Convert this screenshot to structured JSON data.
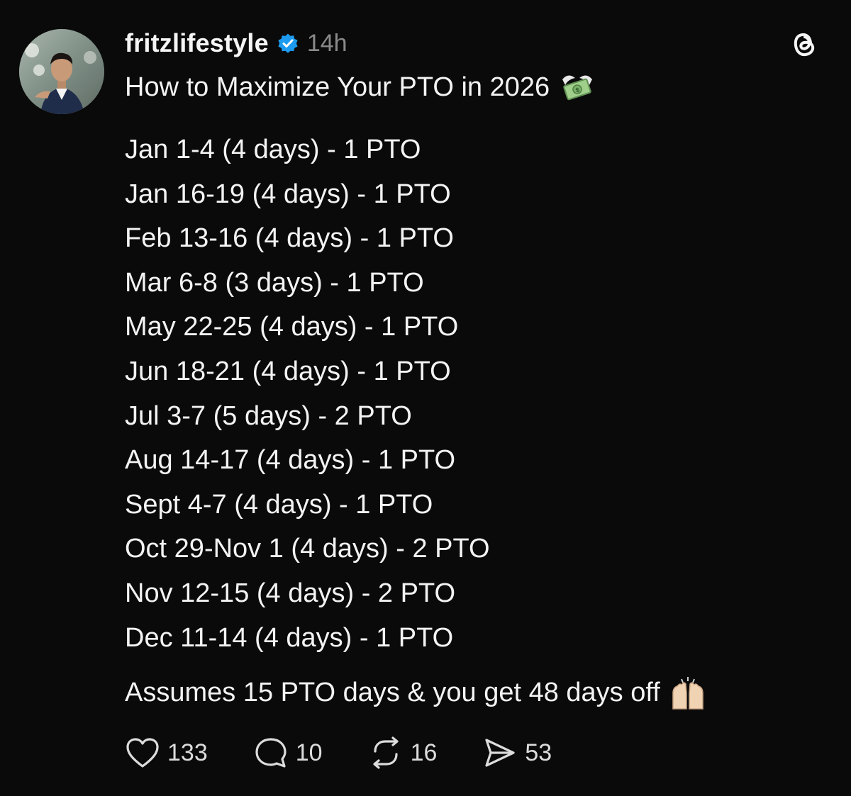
{
  "post": {
    "username": "fritzlifestyle",
    "timestamp": "14h",
    "title": "How to Maximize Your PTO in 2026",
    "title_emoji": "money-with-wings-icon",
    "schedule": [
      "Jan 1-4 (4 days) - 1 PTO",
      "Jan 16-19 (4 days) - 1 PTO",
      "Feb 13-16 (4 days) - 1 PTO",
      "Mar 6-8 (3 days) - 1 PTO",
      "May 22-25 (4 days) - 1 PTO",
      "Jun 18-21 (4 days) - 1 PTO",
      "Jul 3-7 (5 days) - 2 PTO",
      "Aug 14-17 (4 days) - 1 PTO",
      "Sept 4-7 (4 days) - 1 PTO",
      "Oct 29-Nov 1 (4 days) - 2 PTO",
      "Nov 12-15 (4 days) - 2 PTO",
      "Dec 11-14 (4 days) - 1 PTO"
    ],
    "footer_note": "Assumes 15 PTO days & you get 48 days off",
    "footer_emoji": "raising-hands-icon"
  },
  "actions": {
    "likes": "133",
    "replies": "10",
    "reposts": "16",
    "shares": "53"
  },
  "colors": {
    "background": "#0a0a0a",
    "text": "#f3f3f3",
    "muted": "#8a8a8a",
    "verified": "#1d9bf0"
  }
}
